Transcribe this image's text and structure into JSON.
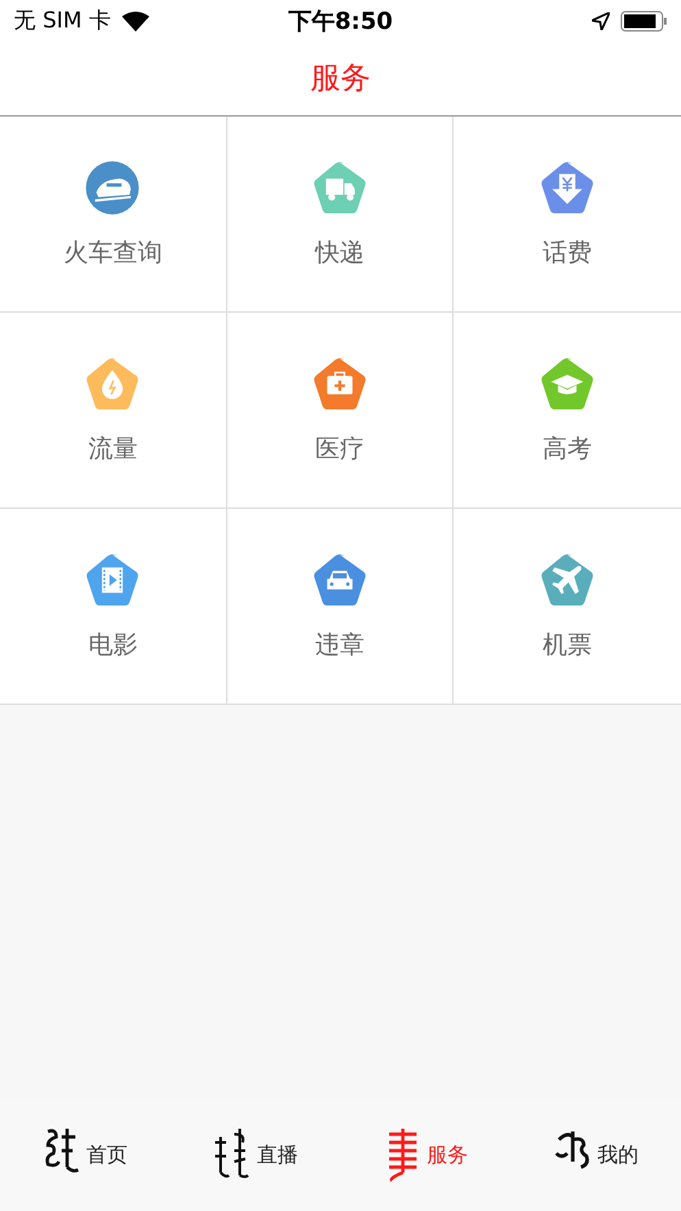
{
  "status_bar": {
    "carrier": "无 SIM 卡",
    "time": "下午8:50"
  },
  "nav": {
    "title": "服务"
  },
  "services": [
    {
      "label": "火车查询",
      "color": "#4a8fc7"
    },
    {
      "label": "快递",
      "color": "#6dcfb3"
    },
    {
      "label": "话费",
      "color": "#6b8fe8"
    },
    {
      "label": "流量",
      "color": "#fdbb5c"
    },
    {
      "label": "医疗",
      "color": "#f47a2c"
    },
    {
      "label": "高考",
      "color": "#72c72a"
    },
    {
      "label": "电影",
      "color": "#4fa4ee"
    },
    {
      "label": "违章",
      "color": "#4a8fe0"
    },
    {
      "label": "机票",
      "color": "#5aaebb"
    }
  ],
  "tabs": [
    {
      "label": "首页",
      "selected": false
    },
    {
      "label": "直播",
      "selected": false
    },
    {
      "label": "服务",
      "selected": true
    },
    {
      "label": "我的",
      "selected": false
    }
  ]
}
